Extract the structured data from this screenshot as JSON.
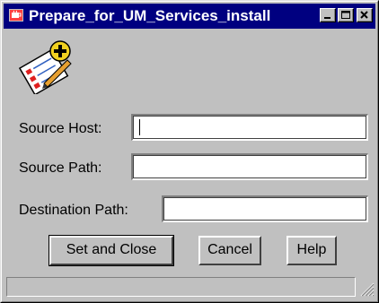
{
  "window": {
    "title": "Prepare_for_UM_Services_install",
    "icon": "java-cup-icon",
    "controls": {
      "minimize": "minimize-icon",
      "maximize": "maximize-icon",
      "close": "close-icon"
    }
  },
  "header_icon": "checklist-plus-icon",
  "form": {
    "source_host": {
      "label": "Source Host:",
      "value": ""
    },
    "source_path": {
      "label": "Source Path:",
      "value": ""
    },
    "destination_path": {
      "label": "Destination Path:",
      "value": ""
    }
  },
  "buttons": {
    "set_and_close": "Set and Close",
    "cancel": "Cancel",
    "help": "Help"
  },
  "status_bar": {
    "text": ""
  },
  "colors": {
    "titlebar": "#000080",
    "dialog_background": "#c0c0c0",
    "field_background": "#ffffff"
  }
}
